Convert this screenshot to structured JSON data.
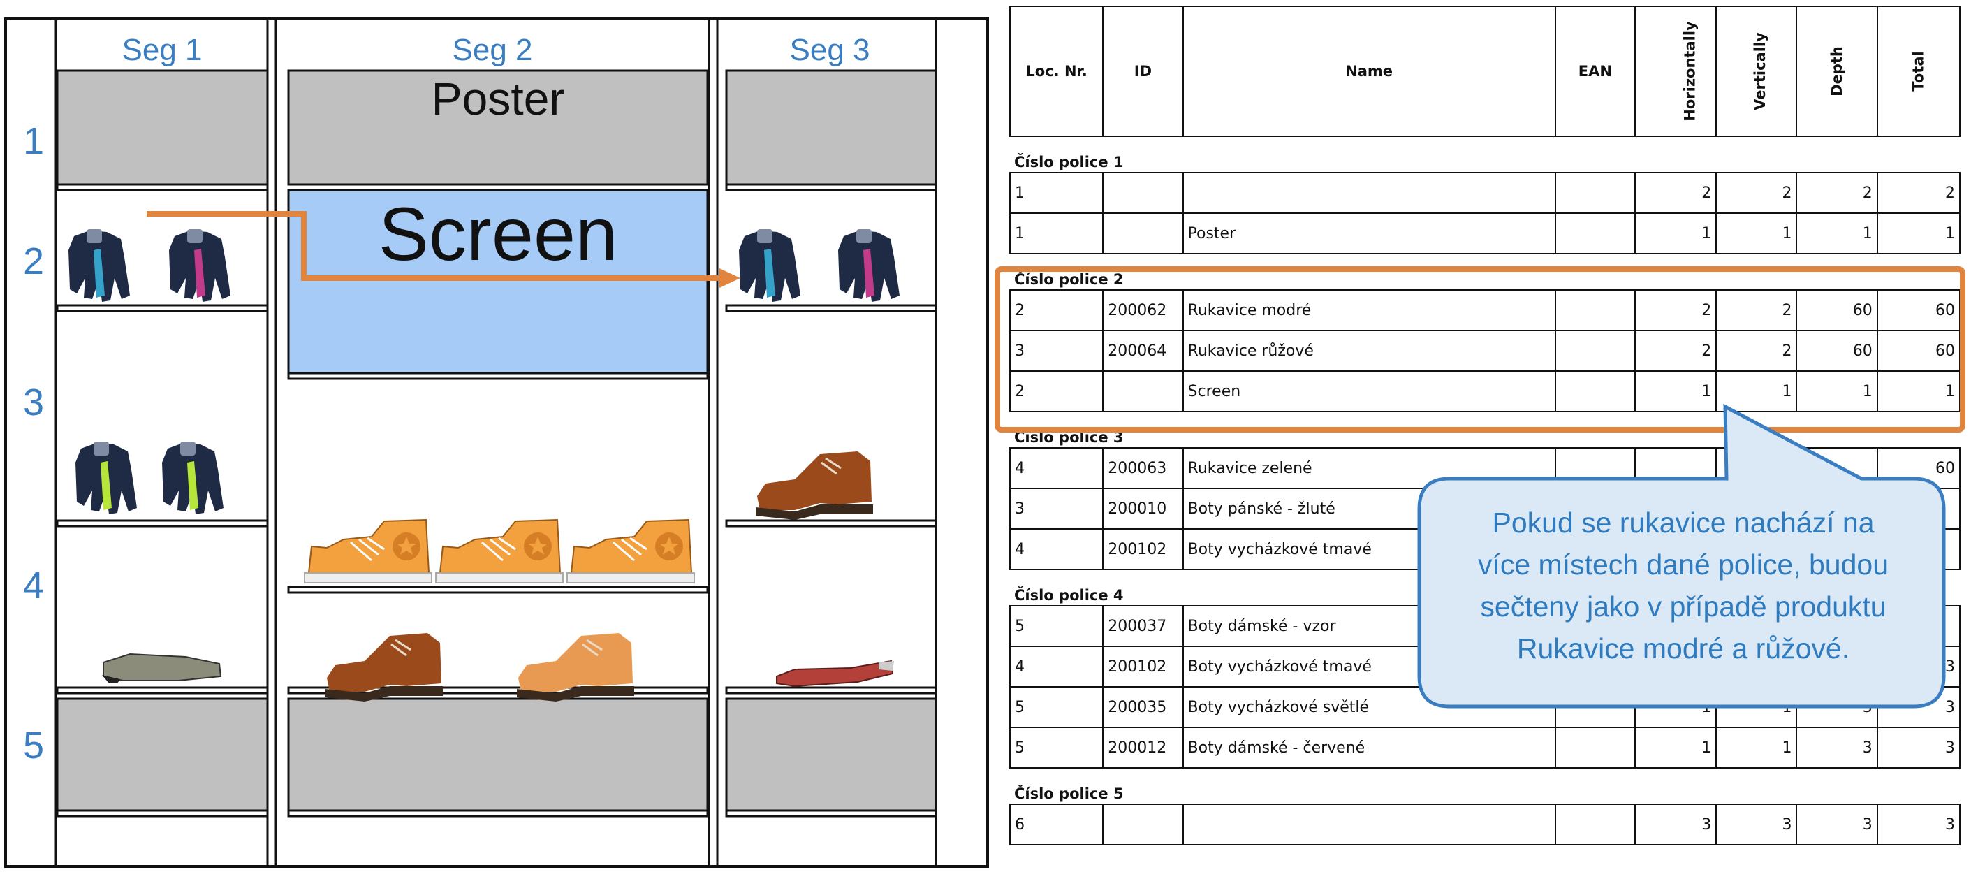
{
  "diagram": {
    "segments": [
      "Seg 1",
      "Seg 2",
      "Seg 3"
    ],
    "shelf_numbers": [
      "1",
      "2",
      "3",
      "4",
      "5"
    ],
    "poster_label": "Poster",
    "screen_label": "Screen",
    "colors": {
      "seg_label": "#3a7dc0",
      "shelf_gray": "#c0c0c0",
      "screen_blue": "#a6cbf7",
      "arrow_orange": "#e0843e"
    }
  },
  "table": {
    "headers": {
      "loc": "Loc. Nr.",
      "id": "ID",
      "name": "Name",
      "ean": "EAN",
      "horizontally": "Horizontally",
      "vertically": "Vertically",
      "depth": "Depth",
      "total": "Total"
    },
    "sections": [
      {
        "title": "Číslo police 1",
        "rows": [
          [
            "1",
            "",
            "",
            "",
            "2",
            "2",
            "2",
            "2"
          ],
          [
            "1",
            "",
            "Poster",
            "",
            "1",
            "1",
            "1",
            "1"
          ]
        ]
      },
      {
        "title": "Číslo police 2",
        "rows": [
          [
            "2",
            "200062",
            "Rukavice modré",
            "",
            "2",
            "2",
            "60",
            "60"
          ],
          [
            "3",
            "200064",
            "Rukavice růžové",
            "",
            "2",
            "2",
            "60",
            "60"
          ],
          [
            "2",
            "",
            "Screen",
            "",
            "1",
            "1",
            "1",
            "1"
          ]
        ]
      },
      {
        "title": "Číslo police 3",
        "rows": [
          [
            "4",
            "200063",
            "Rukavice zelené",
            "",
            "",
            "",
            "",
            "60"
          ],
          [
            "3",
            "200010",
            "Boty pánské - žluté",
            "",
            "",
            "",
            "",
            ""
          ],
          [
            "4",
            "200102",
            "Boty vycházkové tmavé",
            "",
            "",
            "",
            "",
            ""
          ]
        ]
      },
      {
        "title": "Číslo police 4",
        "rows": [
          [
            "5",
            "200037",
            "Boty dámské - vzor",
            "",
            "",
            "",
            "",
            ""
          ],
          [
            "4",
            "200102",
            "Boty vycházkové tmavé",
            "",
            "",
            "",
            "",
            "3"
          ],
          [
            "5",
            "200035",
            "Boty vycházkové světlé",
            "",
            "1",
            "1",
            "3",
            "3"
          ],
          [
            "5",
            "200012",
            "Boty dámské - červené",
            "",
            "1",
            "1",
            "3",
            "3"
          ]
        ]
      },
      {
        "title": "Číslo police 5",
        "rows": [
          [
            "6",
            "",
            "",
            "",
            "3",
            "3",
            "3",
            "3"
          ]
        ]
      }
    ]
  },
  "callout": {
    "lines": [
      "Pokud se rukavice nachází na",
      "více místech dané police, budou",
      "sečteny jako v případě produktu",
      "Rukavice modré a růžové."
    ]
  }
}
